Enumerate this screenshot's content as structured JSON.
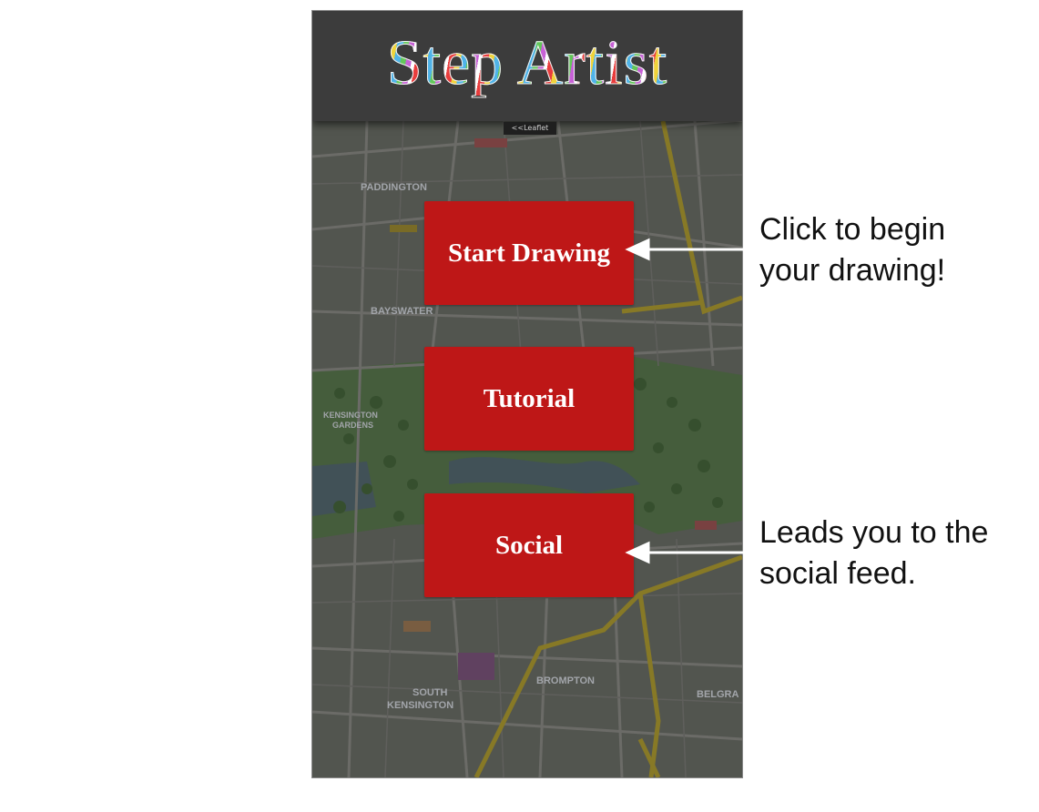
{
  "app": {
    "title": "Step Artist",
    "map_badge": "<<Leaflet"
  },
  "menu": {
    "start_label": "Start Drawing",
    "tutorial_label": "Tutorial",
    "social_label": "Social"
  },
  "map_labels": {
    "paddington": "PADDINGTON",
    "bayswater": "BAYSWATER",
    "kensington_gardens_1": "KENSINGTON",
    "kensington_gardens_2": "GARDENS",
    "south_kensington_1": "SOUTH",
    "south_kensington_2": "KENSINGTON",
    "brompton": "BROMPTON",
    "belgravia": "BELGRA"
  },
  "annotations": {
    "start_note_line1": "Click to begin",
    "start_note_line2": "your drawing!",
    "social_note_line1": "Leads you to the",
    "social_note_line2": "social feed."
  },
  "colors": {
    "button_red": "#be1717",
    "header_dark": "#3c3c3c",
    "arrow": "#ffffff"
  }
}
